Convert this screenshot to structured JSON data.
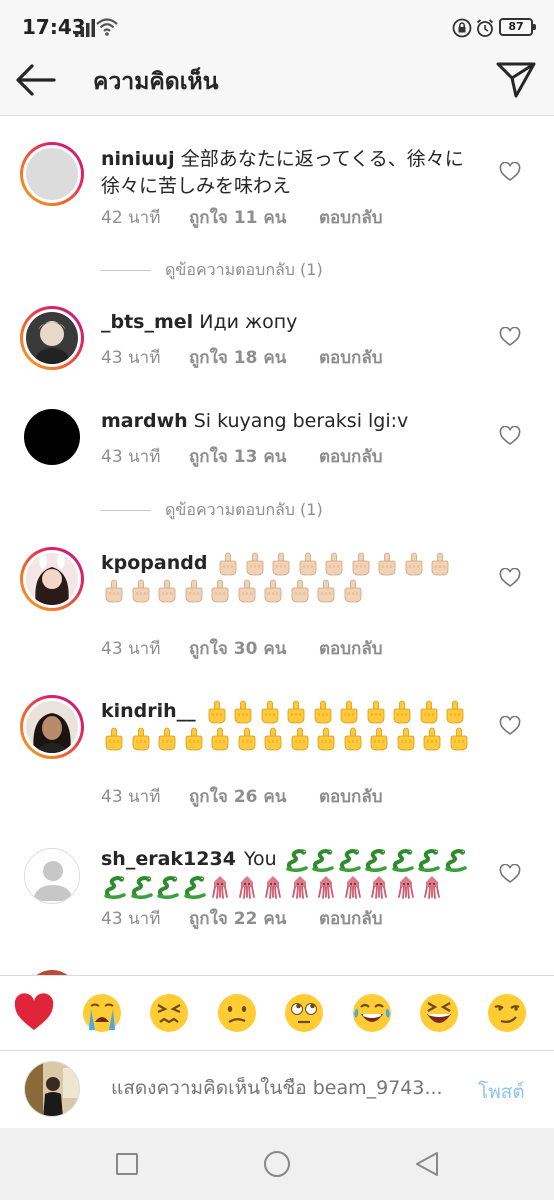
{
  "status": {
    "time": "17:43",
    "battery": "87"
  },
  "header": {
    "title": "ความคิดเห็น",
    "back_icon": "back-arrow-icon",
    "send_icon": "paper-plane-icon"
  },
  "comments": [
    {
      "username": "niniuuj",
      "text": "全部あなたに返ってくる、徐々に徐々に苦しみを味わえ",
      "time": "42 นาที",
      "likes": "ถูกใจ 11 คน",
      "reply": "ตอบกลับ",
      "avatar": "placeholder-gray",
      "view_replies": "ดูข้อความตอบกลับ (1)"
    },
    {
      "username": "_bts_mel",
      "text": "Иди жопу",
      "time": "43 นาที",
      "likes": "ถูกใจ 18 คน",
      "reply": "ตอบกลับ",
      "avatar": "photo-person-blond"
    },
    {
      "username": "mardwh",
      "text": "Si kuyang beraksi lgi:v",
      "time": "43 นาที",
      "likes": "ถูกใจ 13 คน",
      "reply": "ตอบกลับ",
      "avatar": "black-circle",
      "view_replies": "ดูข้อความตอบกลับ (1)"
    },
    {
      "username": "kpopandd",
      "text": "",
      "emoji": "middle-finger-light",
      "emoji_count": 19,
      "time": "43 นาที",
      "likes": "ถูกใจ 30 คน",
      "reply": "ตอบกลับ",
      "avatar": "photo-person-bunny"
    },
    {
      "username": "kindrih__",
      "text": "",
      "emoji": "middle-finger-yellow",
      "emoji_count": 24,
      "time": "43 นาที",
      "likes": "ถูกใจ 26 คน",
      "reply": "ตอบกลับ",
      "avatar": "photo-person-dark-hair"
    },
    {
      "username": "sh_erak1234",
      "text": "You",
      "emoji_snake_count": 11,
      "emoji_squid_count": 9,
      "time": "43 นาที",
      "likes": "ถูกใจ 22 คน",
      "reply": "ตอบกลับ",
      "avatar": "default-silhouette"
    }
  ],
  "reactions": [
    "red-heart",
    "loudly-crying-face",
    "confounded-face",
    "confused-face",
    "face-with-rolling-eyes",
    "face-with-tears-of-joy",
    "grinning-squinting-face",
    "smirking-face"
  ],
  "input": {
    "placeholder": "แสดงความคิดเห็นในชื่อ beam_9743...",
    "post_label": "โพสต์"
  },
  "colors": {
    "link_blue": "#8fc3f0",
    "meta_gray": "#8e8e8e",
    "ring_start": "#f9a824",
    "ring_end": "#b81e8c"
  }
}
